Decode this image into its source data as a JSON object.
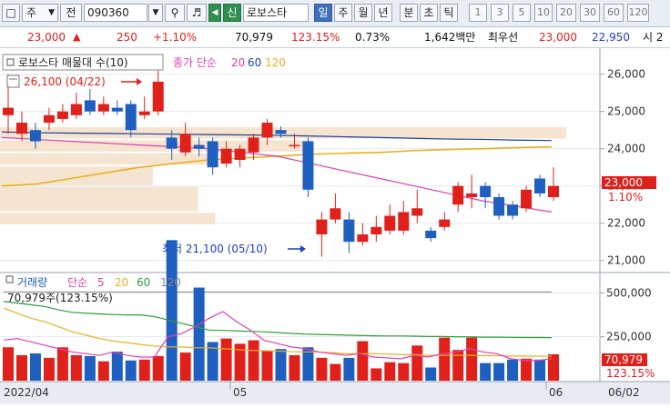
{
  "toolbar": {
    "market_select": "주",
    "period_select": "전",
    "code_input": "090360",
    "signal_label": "신",
    "stock_name": "로보스타",
    "period_tabs": [
      "일",
      "주",
      "월",
      "년",
      "분",
      "초",
      "틱"
    ],
    "active_period": "일",
    "interval_buttons": [
      "1",
      "3",
      "5",
      "10",
      "20",
      "30",
      "60",
      "120"
    ]
  },
  "quote": {
    "price": "23,000",
    "change": "250",
    "change_pct": "+1.10%",
    "volume": "70,979",
    "volume_ratio": "123.15%",
    "turnover_pct": "0.73%",
    "trade_value": "1,642백만",
    "best_label": "최우선",
    "ask": "23,000",
    "bid": "22,950",
    "trailing": "시 2"
  },
  "price_panel": {
    "legend_title": "로보스타 매물대 수(10)",
    "ma_label": "종가 단순",
    "ma_periods": [
      "20",
      "60",
      "120"
    ],
    "high_annotation": "26,100 (04/22)",
    "low_annotation": "최저 21,100 (05/10)",
    "last_price_label": "23,000",
    "last_change_label": "1.10%",
    "y_ticks": [
      "26,000",
      "25,000",
      "24,000",
      "23,000",
      "22,000",
      "21,000"
    ]
  },
  "volume_panel": {
    "legend_title": "거래량",
    "ma_label": "단순",
    "ma_periods": [
      "5",
      "20",
      "60",
      "120"
    ],
    "current_label": "70,979주(123.15%)",
    "y_ticks": [
      "500,000",
      "250,000"
    ],
    "last_volume_label": "70,979",
    "last_ratio_label": "123.15%"
  },
  "x_axis": {
    "labels": [
      "2022/04",
      "05",
      "06"
    ],
    "right_label": "06/02"
  },
  "colors": {
    "up": "#e0201b",
    "down": "#1f5fbf",
    "ma20": "#e040b0",
    "ma60": "#1f3fa0",
    "ma120": "#e8b020",
    "vol_ma5": "#e040b0",
    "vol_ma20": "#e8b020",
    "vol_ma60": "#2e9e3e",
    "vol_ma120": "#888888",
    "volume_profile": "#f5e4cf"
  },
  "chart_data": {
    "type": "candlestick",
    "ylim": [
      20700,
      26700
    ],
    "candles": [
      {
        "o": 24900,
        "c": 25100,
        "h": 26000,
        "l": 24400
      },
      {
        "o": 24400,
        "c": 24700,
        "h": 25000,
        "l": 24200
      },
      {
        "o": 24500,
        "c": 24200,
        "h": 24700,
        "l": 24000
      },
      {
        "o": 24700,
        "c": 24900,
        "h": 25100,
        "l": 24500
      },
      {
        "o": 24800,
        "c": 25000,
        "h": 25200,
        "l": 24700
      },
      {
        "o": 24900,
        "c": 25200,
        "h": 25500,
        "l": 24800
      },
      {
        "o": 25300,
        "c": 25000,
        "h": 25600,
        "l": 24900
      },
      {
        "o": 25000,
        "c": 25200,
        "h": 25400,
        "l": 24900
      },
      {
        "o": 25100,
        "c": 25000,
        "h": 25300,
        "l": 24900
      },
      {
        "o": 25200,
        "c": 24500,
        "h": 25300,
        "l": 24300
      },
      {
        "o": 24900,
        "c": 25000,
        "h": 25400,
        "l": 24800
      },
      {
        "o": 25000,
        "c": 25800,
        "h": 26100,
        "l": 24900
      },
      {
        "o": 24300,
        "c": 24000,
        "h": 24500,
        "l": 23700
      },
      {
        "o": 23900,
        "c": 24400,
        "h": 24700,
        "l": 23800
      },
      {
        "o": 24100,
        "c": 24000,
        "h": 24300,
        "l": 23800
      },
      {
        "o": 24200,
        "c": 23500,
        "h": 24300,
        "l": 23300
      },
      {
        "o": 23600,
        "c": 24000,
        "h": 24200,
        "l": 23500
      },
      {
        "o": 23700,
        "c": 24000,
        "h": 24100,
        "l": 23500
      },
      {
        "o": 23900,
        "c": 24300,
        "h": 24400,
        "l": 23700
      },
      {
        "o": 24300,
        "c": 24700,
        "h": 24800,
        "l": 24100
      },
      {
        "o": 24500,
        "c": 24400,
        "h": 24600,
        "l": 24300
      },
      {
        "o": 24100,
        "c": 24100,
        "h": 24400,
        "l": 24000
      },
      {
        "o": 24200,
        "c": 22900,
        "h": 24300,
        "l": 22700
      },
      {
        "o": 21700,
        "c": 22100,
        "h": 22300,
        "l": 21100
      },
      {
        "o": 22100,
        "c": 22400,
        "h": 22800,
        "l": 22000
      },
      {
        "o": 22100,
        "c": 21500,
        "h": 22300,
        "l": 21200
      },
      {
        "o": 21500,
        "c": 21700,
        "h": 22000,
        "l": 21400
      },
      {
        "o": 21700,
        "c": 21900,
        "h": 22200,
        "l": 21500
      },
      {
        "o": 21800,
        "c": 22200,
        "h": 22500,
        "l": 21700
      },
      {
        "o": 21800,
        "c": 22300,
        "h": 22600,
        "l": 21700
      },
      {
        "o": 22200,
        "c": 22400,
        "h": 22900,
        "l": 22000
      },
      {
        "o": 21800,
        "c": 21600,
        "h": 21900,
        "l": 21500
      },
      {
        "o": 21900,
        "c": 22100,
        "h": 22300,
        "l": 21800
      },
      {
        "o": 22500,
        "c": 23000,
        "h": 23100,
        "l": 22300
      },
      {
        "o": 22700,
        "c": 22800,
        "h": 23300,
        "l": 22400
      },
      {
        "o": 23000,
        "c": 22700,
        "h": 23100,
        "l": 22400
      },
      {
        "o": 22700,
        "c": 22200,
        "h": 22800,
        "l": 22100
      },
      {
        "o": 22500,
        "c": 22200,
        "h": 22600,
        "l": 22100
      },
      {
        "o": 22400,
        "c": 22900,
        "h": 23000,
        "l": 22300
      },
      {
        "o": 23200,
        "c": 22800,
        "h": 23300,
        "l": 22700
      },
      {
        "o": 22700,
        "c": 23000,
        "h": 23500,
        "l": 22600
      }
    ],
    "ma20": [
      24300,
      24250,
      24200,
      24150,
      24100,
      24050,
      24000,
      23900,
      23800,
      23600,
      23400,
      23200,
      23000,
      22800,
      22600,
      22450,
      22300
    ],
    "ma60": [
      24450,
      24430,
      24420,
      24410,
      24400,
      24390,
      24380,
      24370,
      24360,
      24340,
      24320,
      24300,
      24280,
      24260,
      24250,
      24230,
      24220
    ],
    "ma120": [
      23000,
      23050,
      23200,
      23350,
      23500,
      23600,
      23700,
      23750,
      23800,
      23850,
      23880,
      23900,
      23950,
      23980,
      24000,
      24030,
      24050
    ],
    "volume_profile": [
      {
        "lo": 24250,
        "hi": 24600,
        "w": 1.0
      },
      {
        "lo": 23900,
        "hi": 24250,
        "w": 0.55
      },
      {
        "lo": 23550,
        "hi": 23900,
        "w": 0.38
      },
      {
        "lo": 23000,
        "hi": 23550,
        "w": 0.27
      },
      {
        "lo": 22300,
        "hi": 23000,
        "w": 0.35
      },
      {
        "lo": 21950,
        "hi": 22300,
        "w": 0.38
      }
    ],
    "volume": [
      190,
      145,
      155,
      130,
      190,
      145,
      140,
      110,
      165,
      115,
      120,
      140,
      800,
      160,
      530,
      220,
      240,
      210,
      230,
      170,
      180,
      145,
      190,
      130,
      95,
      130,
      225,
      70,
      105,
      100,
      200,
      75,
      245,
      175,
      245,
      100,
      100,
      120,
      125,
      120,
      150
    ],
    "volume_unit": "천주",
    "volume_ylim": [
      0,
      600
    ]
  }
}
